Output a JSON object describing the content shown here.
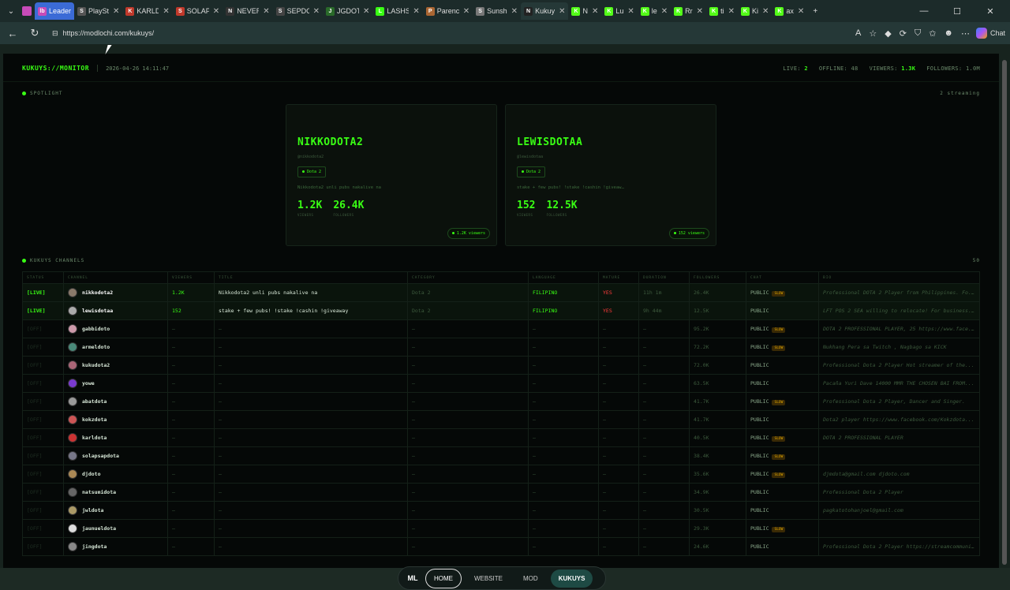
{
  "browser": {
    "tabs": [
      {
        "title": "Leaderboa",
        "fav": "lb",
        "color": "#c74bb8",
        "highlight": true
      },
      {
        "title": "PlaySt",
        "fav": "S",
        "color": "#555"
      },
      {
        "title": "KARLD",
        "fav": "K",
        "color": "#c0392b"
      },
      {
        "title": "SOLAP",
        "fav": "S",
        "color": "#c0392b"
      },
      {
        "title": "NEVER",
        "fav": "N",
        "color": "#333"
      },
      {
        "title": "SEPDO",
        "fav": "S",
        "color": "#444"
      },
      {
        "title": "JGDOT",
        "fav": "J",
        "color": "#2a6a2a"
      },
      {
        "title": "LASHS",
        "fav": "L",
        "color": "#39ff14"
      },
      {
        "title": "Parenc",
        "fav": "P",
        "color": "#aa6633"
      },
      {
        "title": "Sunsh",
        "fav": "S",
        "color": "#777"
      },
      {
        "title": "Kukuy",
        "fav": "N",
        "color": "#222",
        "active": true
      },
      {
        "title": "N",
        "fav": "K",
        "color": "#53fc18"
      },
      {
        "title": "Lu",
        "fav": "K",
        "color": "#53fc18"
      },
      {
        "title": "le",
        "fav": "K",
        "color": "#53fc18"
      },
      {
        "title": "Rr",
        "fav": "K",
        "color": "#53fc18"
      },
      {
        "title": "ti",
        "fav": "K",
        "color": "#53fc18"
      },
      {
        "title": "Ki",
        "fav": "K",
        "color": "#53fc18"
      },
      {
        "title": "ax",
        "fav": "K",
        "color": "#53fc18"
      }
    ],
    "url": "https://modlochi.com/kukuys/",
    "copilot_label": "Chat"
  },
  "header": {
    "brand": "KUKUYS://MONITOR",
    "datetime": "2026-04-26 14:11:47",
    "live_label": "LIVE:",
    "live_value": "2",
    "offline_label": "OFFLINE:",
    "offline_value": "48",
    "viewers_label": "VIEWERS:",
    "viewers_value": "1.3K",
    "followers_label": "FOLLOWERS:",
    "followers_value": "1.0M"
  },
  "spotlight": {
    "label": "SPOTLIGHT",
    "count": "2 streaming",
    "cards": [
      {
        "name": "NIKKODOTA2",
        "handle": "@nikkodota2",
        "category": "Dota 2",
        "desc": "Nikkodota2 unli pubs nakalive na",
        "viewers": "1.2K",
        "viewers_label": "VIEWERS",
        "followers": "26.4K",
        "followers_label": "FOLLOWERS",
        "badge": "1.2K viewers"
      },
      {
        "name": "LEWISDOTAA",
        "handle": "@lewisdotaa",
        "category": "Dota 2",
        "desc": "stake + few pubs! !stake !cashin !giveaw…",
        "viewers": "152",
        "viewers_label": "VIEWERS",
        "followers": "12.5K",
        "followers_label": "FOLLOWERS",
        "badge": "152 viewers"
      }
    ]
  },
  "channels": {
    "label": "KUKUYS CHANNELS",
    "count": "50",
    "columns": [
      "STATUS",
      "CHANNEL",
      "VIEWERS",
      "TITLE",
      "CATEGORY",
      "LANGUAGE",
      "MATURE",
      "DURATION",
      "FOLLOWERS",
      "CHAT",
      "BIO"
    ],
    "rows": [
      {
        "status": "[LIVE]",
        "live": true,
        "channel": "nikkodota2",
        "av": "#8a7a6a",
        "viewers": "1.2K",
        "title": "Nikkodota2 unli pubs nakalive na",
        "category": "Dota 2",
        "language": "FILIPINO",
        "mature": "YES",
        "duration": "11h 1m",
        "followers": "26.4K",
        "chat": "PUBLIC",
        "slow": "SLOW",
        "bio": "Professional DOTA 2 Player from Philippines. Fo..."
      },
      {
        "status": "[LIVE]",
        "live": true,
        "channel": "lewisdotaa",
        "av": "#aaa",
        "viewers": "152",
        "title": "stake + few pubs! !stake !cashin !giveaway",
        "category": "Dota 2",
        "language": "FILIPINO",
        "mature": "YES",
        "duration": "9h 44m",
        "followers": "12.5K",
        "chat": "PUBLIC",
        "slow": "",
        "bio": "LFT POS 2 SEA willing to relocate! For business..."
      },
      {
        "status": "[OFF]",
        "channel": "gabbidoto",
        "av": "#c9a",
        "viewers": "–",
        "title": "–",
        "category": "–",
        "language": "–",
        "mature": "–",
        "duration": "–",
        "followers": "95.2K",
        "chat": "PUBLIC",
        "slow": "SLOW",
        "bio": "DOTA 2 PROFESSIONAL PLAYER, 25 https://www.face..."
      },
      {
        "status": "[OFF]",
        "channel": "armeldoto",
        "av": "#4a8a7a",
        "viewers": "–",
        "title": "–",
        "category": "–",
        "language": "–",
        "mature": "–",
        "duration": "–",
        "followers": "72.2K",
        "chat": "PUBLIC",
        "slow": "SLOW",
        "bio": "Nukhang Pera sa Twitch , Nagbago sa KICK"
      },
      {
        "status": "[OFF]",
        "channel": "kukudota2",
        "av": "#a67",
        "viewers": "–",
        "title": "–",
        "category": "–",
        "language": "–",
        "mature": "–",
        "duration": "–",
        "followers": "72.0K",
        "chat": "PUBLIC",
        "slow": "",
        "bio": "Professional Dota 2 Player Hot streamer of the..."
      },
      {
        "status": "[OFF]",
        "channel": "yowe",
        "av": "#7a3ad0",
        "viewers": "–",
        "title": "–",
        "category": "–",
        "language": "–",
        "mature": "–",
        "duration": "–",
        "followers": "63.5K",
        "chat": "PUBLIC",
        "slow": "",
        "bio": "Pacaña Yuri Dave 14000 MMR THE CHOSEN BAI FROM..."
      },
      {
        "status": "[OFF]",
        "channel": "abatdota",
        "av": "#999",
        "viewers": "–",
        "title": "–",
        "category": "–",
        "language": "–",
        "mature": "–",
        "duration": "–",
        "followers": "41.7K",
        "chat": "PUBLIC",
        "slow": "SLOW",
        "bio": "Professional Dota 2 Player, Dancer and Singer."
      },
      {
        "status": "[OFF]",
        "channel": "kokzdota",
        "av": "#c55",
        "viewers": "–",
        "title": "–",
        "category": "–",
        "language": "–",
        "mature": "–",
        "duration": "–",
        "followers": "41.7K",
        "chat": "PUBLIC",
        "slow": "",
        "bio": "Dota2 player https://www.facebook.com/Kokzdota..."
      },
      {
        "status": "[OFF]",
        "channel": "karldota",
        "av": "#c33",
        "viewers": "–",
        "title": "–",
        "category": "–",
        "language": "–",
        "mature": "–",
        "duration": "–",
        "followers": "40.5K",
        "chat": "PUBLIC",
        "slow": "SLOW",
        "bio": "DOTA 2 PROFESSIONAL PLAYER"
      },
      {
        "status": "[OFF]",
        "channel": "solapsapdota",
        "av": "#778",
        "viewers": "–",
        "title": "–",
        "category": "–",
        "language": "–",
        "mature": "–",
        "duration": "–",
        "followers": "38.4K",
        "chat": "PUBLIC",
        "slow": "SLOW",
        "bio": ""
      },
      {
        "status": "[OFF]",
        "channel": "djdoto",
        "av": "#aa8855",
        "viewers": "–",
        "title": "–",
        "category": "–",
        "language": "–",
        "mature": "–",
        "duration": "–",
        "followers": "35.6K",
        "chat": "PUBLIC",
        "slow": "SLOW",
        "bio": "djmdota@gmail.com djdoto.com"
      },
      {
        "status": "[OFF]",
        "channel": "natsumidota",
        "av": "#666",
        "viewers": "–",
        "title": "–",
        "category": "–",
        "language": "–",
        "mature": "–",
        "duration": "–",
        "followers": "34.9K",
        "chat": "PUBLIC",
        "slow": "",
        "bio": "Professional Dota 2 Player"
      },
      {
        "status": "[OFF]",
        "channel": "jwldota",
        "av": "#aa9966",
        "viewers": "–",
        "title": "–",
        "category": "–",
        "language": "–",
        "mature": "–",
        "duration": "–",
        "followers": "30.5K",
        "chat": "PUBLIC",
        "slow": "",
        "bio": "pagkatotohanjoel@gmail.com"
      },
      {
        "status": "[OFF]",
        "channel": "jaunueldota",
        "av": "#ddd",
        "viewers": "–",
        "title": "–",
        "category": "–",
        "language": "–",
        "mature": "–",
        "duration": "–",
        "followers": "29.3K",
        "chat": "PUBLIC",
        "slow": "SLOW",
        "bio": ""
      },
      {
        "status": "[OFF]",
        "channel": "jingdota",
        "av": "#888",
        "viewers": "–",
        "title": "–",
        "category": "–",
        "language": "–",
        "mature": "–",
        "duration": "–",
        "followers": "24.6K",
        "chat": "PUBLIC",
        "slow": "",
        "bio": "Professional Dota 2 Player https://streamcommuni..."
      }
    ]
  },
  "bottomnav": {
    "logo": "ML",
    "home": "HOME",
    "website": "WEBSITE",
    "mod": "MOD",
    "kukuys": "KUKUYS"
  },
  "colors": {
    "accent": "#39ff14",
    "background": "#050807",
    "mature": "#ff3b3b",
    "slow": "#d9a000"
  }
}
